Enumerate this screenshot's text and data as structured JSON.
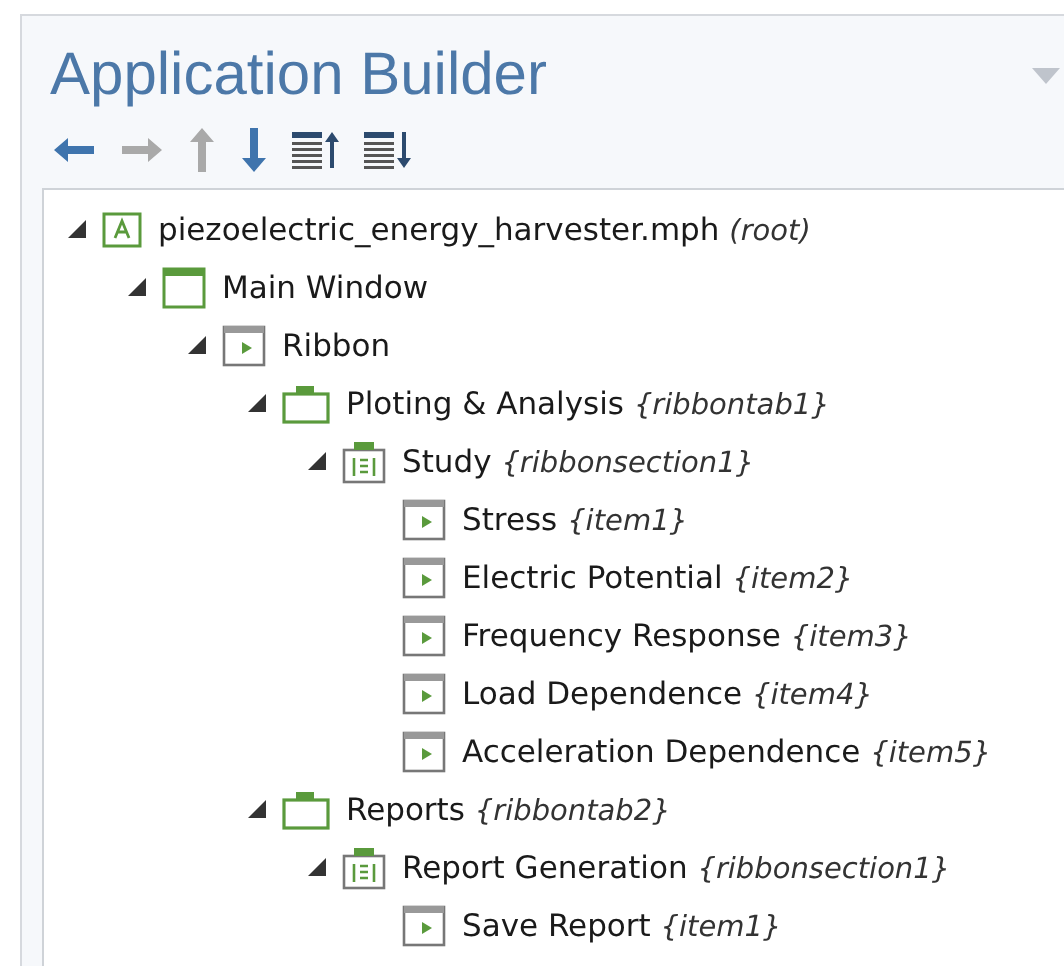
{
  "panel": {
    "title": "Application Builder"
  },
  "toolbar": [
    {
      "kind": "left",
      "disabled": false
    },
    {
      "kind": "right",
      "disabled": true
    },
    {
      "kind": "up",
      "disabled": true
    },
    {
      "kind": "down",
      "disabled": false
    },
    {
      "kind": "list-up",
      "disabled": false
    },
    {
      "kind": "list-down",
      "disabled": false
    }
  ],
  "tree": [
    {
      "kind": "root",
      "label": "piezoelectric_energy_harvester.mph",
      "tag": "(root)",
      "expanded": true,
      "children": [
        {
          "kind": "window",
          "label": "Main Window",
          "expanded": true,
          "children": [
            {
              "kind": "ribbon",
              "label": "Ribbon",
              "expanded": true,
              "children": [
                {
                  "kind": "tab",
                  "label": "Ploting & Analysis",
                  "tag": "{ribbontab1}",
                  "expanded": true,
                  "children": [
                    {
                      "kind": "section",
                      "label": "Study",
                      "tag": "{ribbonsection1}",
                      "expanded": true,
                      "children": [
                        {
                          "kind": "item",
                          "label": "Stress",
                          "tag": "{item1}"
                        },
                        {
                          "kind": "item",
                          "label": "Electric Potential",
                          "tag": "{item2}"
                        },
                        {
                          "kind": "item",
                          "label": "Frequency Response",
                          "tag": "{item3}"
                        },
                        {
                          "kind": "item",
                          "label": "Load Dependence",
                          "tag": "{item4}"
                        },
                        {
                          "kind": "item",
                          "label": "Acceleration Dependence",
                          "tag": "{item5}"
                        }
                      ]
                    }
                  ]
                },
                {
                  "kind": "tab",
                  "label": "Reports",
                  "tag": "{ribbontab2}",
                  "expanded": true,
                  "children": [
                    {
                      "kind": "section",
                      "label": "Report Generation",
                      "tag": "{ribbonsection1}",
                      "expanded": true,
                      "children": [
                        {
                          "kind": "item",
                          "label": "Save Report",
                          "tag": "{item1}"
                        }
                      ]
                    }
                  ]
                }
              ]
            }
          ]
        }
      ]
    }
  ]
}
